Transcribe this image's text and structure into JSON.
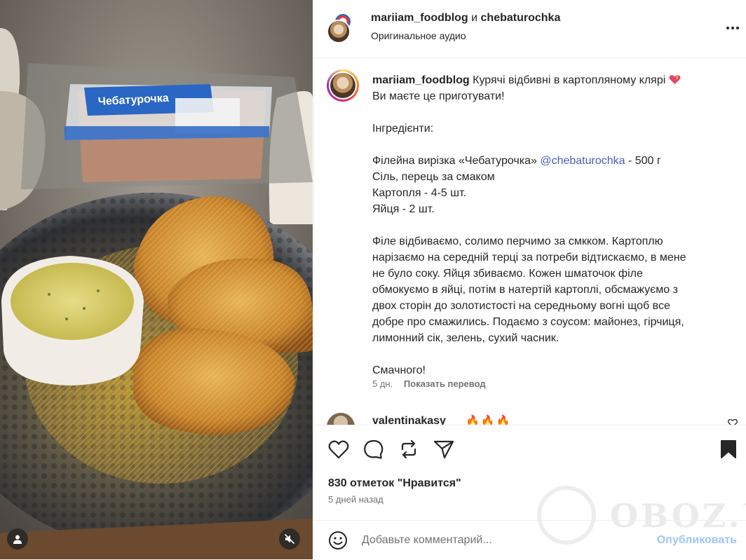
{
  "post": {
    "header": {
      "author": "mariiam_foodblog",
      "conjunction": "и",
      "coauthor": "chebaturochka",
      "audio": "Оригинальное аудио"
    },
    "caption": {
      "username": "mariiam_foodblog",
      "title": "Курячі відбивні в картопляному клярі",
      "line1": "Ви маєте це приготувати!",
      "ingredients_header": "Інгредієнти:",
      "ingredient1_text": "Філейна вирізка «Чебатурочка»",
      "ingredient1_mention": "@chebaturochka",
      "ingredient1_qty": "- 500 г",
      "ingredient2": "Сіль, перець за смаком",
      "ingredient3": "Картопля - 4-5 шт.",
      "ingredient4": "Яйця - 2 шт.",
      "method_line1": "Філе відбиваємо, солимо перчимо за смкком. Картоплю",
      "method_line2": "нарізаємо на середній терці за потреби відтискаємо, в мене",
      "method_line3": "не було соку. Яйця збиваємо. Кожен шматочок філе",
      "method_line4": "обмокуємо в яйці, потім в натертій картоплі, обсмажуємо з",
      "method_line5": "двох сторін до золотистості на середньому вогні щоб все",
      "method_line6": "добре про смажились. Подаємо з соусом: майонез, гірчиця,",
      "method_line7": "лимонний сік, зелень, сухий часник.",
      "closing": "Смачного!",
      "age": "5 дн.",
      "translate_label": "Показать перевод"
    },
    "comment": {
      "username": "valentinakasy",
      "emoji_text": "🔥🔥🔥"
    },
    "likes_text": "830 отметок \"Нравится\"",
    "posted_text": "5 дней назад",
    "composer": {
      "placeholder": "Добавьте комментарий...",
      "publish_label": "Опубликовать"
    },
    "watermark_text": "OBOZ.UA",
    "package_label": "Чебатурочка"
  },
  "colors": {
    "accent_link": "#4a5dbd",
    "publish_disabled": "#9fc6f6",
    "muted": "#737373",
    "text": "#262626"
  },
  "icons": [
    "more-icon",
    "heart-icon",
    "comment-icon",
    "repost-icon",
    "share-icon",
    "bookmark-icon",
    "emoji-icon",
    "user-icon",
    "mute-icon",
    "fire-icon"
  ]
}
